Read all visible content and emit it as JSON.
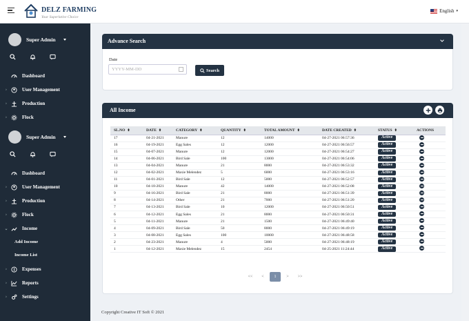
{
  "brand": {
    "name": "DELZ FARMING",
    "tagline": "Your Superlative Choice"
  },
  "language": "English",
  "sidebar": {
    "profile_name": "Super Admin",
    "items_top": [
      {
        "label": "Dashboard",
        "icon": "dashboard-icon"
      },
      {
        "label": "User Management",
        "icon": "user-icon"
      },
      {
        "label": "Production",
        "icon": "production-icon"
      },
      {
        "label": "Flock",
        "icon": "gear-icon"
      }
    ],
    "items_bottom": [
      {
        "label": "Dashboard",
        "icon": "dashboard-icon"
      },
      {
        "label": "User Management",
        "icon": "user-icon"
      },
      {
        "label": "Production",
        "icon": "production-icon"
      },
      {
        "label": "Flock",
        "icon": "gear-icon"
      },
      {
        "label": "Income",
        "icon": "trend-icon"
      },
      {
        "label": "Add Income"
      },
      {
        "label": "Income List"
      },
      {
        "label": "Expenses",
        "icon": "expenses-icon"
      },
      {
        "label": "Reports",
        "icon": "chart-icon"
      },
      {
        "label": "Settings",
        "icon": "settings-icon"
      }
    ]
  },
  "advance_search": {
    "title": "Advance Search",
    "date_label": "Date",
    "date_placeholder": "YYYY-MM-DD",
    "search_label": "Search"
  },
  "income": {
    "title": "All Income",
    "columns": [
      "SL.NO",
      "DATE",
      "CATEGORY",
      "QUANTITY",
      "TOTAL AMOUNT",
      "DATE CREATED",
      "STATUS",
      "ACTIONS"
    ],
    "rows": [
      [
        "17",
        "04-21-2021",
        "Manure",
        "12",
        "14000",
        "04-27-2021 06:57:36",
        "Active"
      ],
      [
        "16",
        "04-19-2021",
        "Egg Sales",
        "12",
        "12000",
        "04-27-2021 06:56:57",
        "Active"
      ],
      [
        "15",
        "04-07-2021",
        "Manure",
        "12",
        "12000",
        "04-27-2021 06:54:27",
        "Active"
      ],
      [
        "14",
        "04-06-2021",
        "Bird Sale",
        "100",
        "13000",
        "04-27-2021 06:54:06",
        "Active"
      ],
      [
        "13",
        "04-04-2021",
        "Manure",
        "21",
        "8000",
        "04-27-2021 06:53:32",
        "Active"
      ],
      [
        "12",
        "04-02-2021",
        "Maxie Melendez",
        "5",
        "6000",
        "04-27-2021 06:53:16",
        "Active"
      ],
      [
        "11",
        "04-01-2021",
        "Bird Sale",
        "12",
        "5000",
        "04-27-2021 06:52:57",
        "Active"
      ],
      [
        "10",
        "04-18-2021",
        "Manure",
        "42",
        "14000",
        "04-27-2021 06:52:08",
        "Active"
      ],
      [
        "9",
        "04-16-2021",
        "Bird Sale",
        "21",
        "8000",
        "04-27-2021 06:51:39",
        "Active"
      ],
      [
        "8",
        "04-14-2021",
        "Other",
        "21",
        "7000",
        "04-27-2021 06:51:20",
        "Active"
      ],
      [
        "7",
        "04-13-2021",
        "Bird Sale",
        "10",
        "12000",
        "04-27-2021 06:50:51",
        "Active"
      ],
      [
        "6",
        "04-12-2021",
        "Egg Sales",
        "21",
        "8000",
        "04-27-2021 06:50:31",
        "Active"
      ],
      [
        "5",
        "04-11-2021",
        "Manure",
        "21",
        "1500",
        "04-27-2021 06:49:40",
        "Active"
      ],
      [
        "4",
        "04-09-2021",
        "Bird Sale",
        "50",
        "8000",
        "04-27-2021 06:49:19",
        "Active"
      ],
      [
        "3",
        "04-08-2021",
        "Egg Sales",
        "100",
        "10000",
        "04-27-2021 06:48:58",
        "Active"
      ],
      [
        "2",
        "04-23-2021",
        "Manure",
        "4",
        "5000",
        "04-27-2021 06:48:19",
        "Active"
      ],
      [
        "1",
        "04-12-2021",
        "Maxie Melendez",
        "15",
        "2454",
        "04-25-2021 11:24:44",
        "Active"
      ]
    ]
  },
  "pagination": [
    "<<",
    "<",
    "1",
    ">",
    ">>"
  ],
  "footer": "Copyright Creative IT Soft © 2021",
  "colors": {
    "sidebar": "#1f2b38",
    "header": "#243343",
    "accent": "#7b8ea8"
  }
}
